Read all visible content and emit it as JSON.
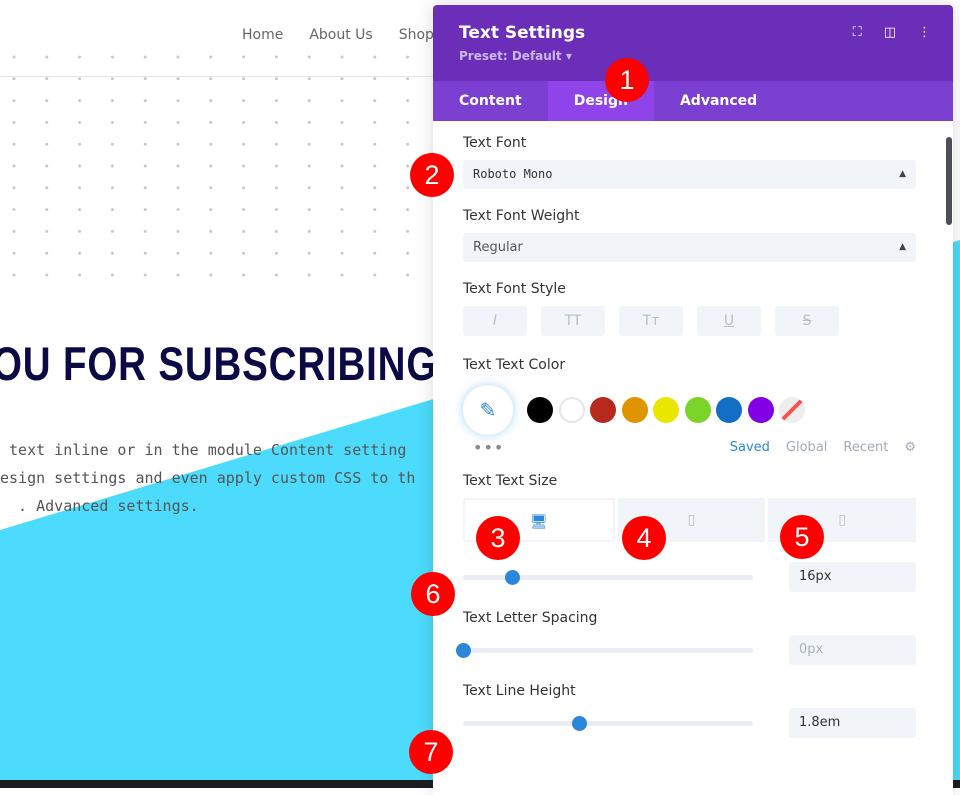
{
  "site": {
    "nav": [
      "Home",
      "About Us",
      "Shop"
    ],
    "headline": "OU FOR SUBSCRIBING!",
    "body_lines": [
      " text inline or in the module Content setting",
      "esign settings and even apply custom CSS to th",
      "  . Advanced settings."
    ]
  },
  "panel": {
    "title": "Text Settings",
    "preset": "Preset: Default ▾",
    "header_icons": [
      "fullscreen-icon",
      "sidebar-layout-icon",
      "more-vertical-icon"
    ],
    "tabs": [
      "Content",
      "Design",
      "Advanced"
    ],
    "active_tab": "Design",
    "font": {
      "label": "Text Font",
      "value": "Roboto Mono"
    },
    "weight": {
      "label": "Text Font Weight",
      "value": "Regular"
    },
    "style": {
      "label": "Text Font Style",
      "buttons": [
        "I",
        "TT",
        "Tт",
        "U",
        "S"
      ]
    },
    "color": {
      "label": "Text Text Color",
      "swatches": [
        "#000000",
        "#ffffff",
        "#b7281e",
        "#e09400",
        "#e9e600",
        "#7ad42a",
        "#136fc4",
        "#8100e6"
      ],
      "more": "•••",
      "palettes": [
        "Saved",
        "Global",
        "Recent"
      ],
      "active_palette": "Saved"
    },
    "size": {
      "label": "Text Text Size",
      "devices": [
        "desktop",
        "tablet",
        "phone"
      ],
      "active_device": "desktop",
      "value": "16px",
      "slider_fraction": 0.17
    },
    "letter_spacing": {
      "label": "Text Letter Spacing",
      "value": "0px",
      "slider_fraction": 0
    },
    "line_height": {
      "label": "Text Line Height",
      "value": "1.8em",
      "slider_fraction": 0.4
    }
  },
  "badges": [
    "1",
    "2",
    "3",
    "4",
    "5",
    "6",
    "7"
  ],
  "colors": {
    "header": "#6a2eb8",
    "tabs": "#7b3fd2",
    "active_tab": "#8e44e8",
    "accent": "#2b87da",
    "cyan": "#4cdbfc",
    "badge": "#ff0000"
  }
}
